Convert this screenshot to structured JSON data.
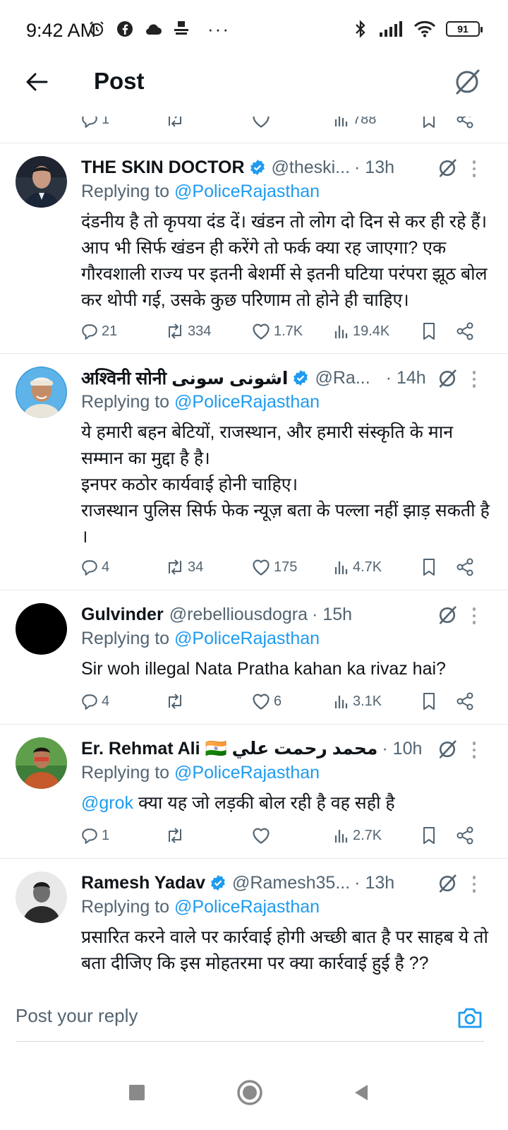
{
  "status_bar": {
    "time": "9:42 AM",
    "battery": "91",
    "icons": [
      "alarm-icon",
      "facebook-icon",
      "cloud-icon",
      "news-app-icon",
      "more-dots",
      "bluetooth-icon",
      "signal-icon",
      "wifi-icon",
      "battery-icon"
    ]
  },
  "header": {
    "title": "Post"
  },
  "partial_row": {
    "replies": "1",
    "views": "788"
  },
  "tweets": [
    {
      "name": "THE SKIN DOCTOR",
      "verified": true,
      "handle": "@theski...",
      "time": "· 13h",
      "replying_prefix": "Replying to",
      "replying_to": "@PoliceRajasthan",
      "body_lines": [
        "दंडनीय है तो कृपया दंड दें। खंडन तो लोग दो दिन से कर ही रहे हैं। आप भी सिर्फ खंडन ही करेंगे तो फर्क क्या रह जाएगा? एक गौरवशाली राज्य पर इतनी बेशर्मी से इतनी घटिया परंपरा झूठ बोल कर थोपी गई, उसके कुछ परिणाम तो होने ही चाहिए।"
      ],
      "replies": "21",
      "reposts": "334",
      "likes": "1.7K",
      "views": "19.4K"
    },
    {
      "name": "अश्विनी सोनी اشونی سونی",
      "verified": true,
      "handle": "@Ra...",
      "time": "· 14h",
      "replying_prefix": "Replying to",
      "replying_to": "@PoliceRajasthan",
      "body_lines": [
        "ये हमारी बहन बेटियों, राजस्थान, और हमारी संस्कृति के मान सम्मान का मुद्दा है है।",
        "इनपर कठोर कार्यवाई होनी चाहिए।",
        "राजस्थान पुलिस सिर्फ फेक न्यूज़ बता के पल्ला नहीं झाड़ सकती है ।"
      ],
      "replies": "4",
      "reposts": "34",
      "likes": "175",
      "views": "4.7K"
    },
    {
      "name": "Gulvinder",
      "verified": false,
      "handle": "@rebelliousdogra",
      "time": "· 15h",
      "replying_prefix": "Replying to",
      "replying_to": "@PoliceRajasthan",
      "body_lines": [
        "Sir woh illegal Nata Pratha kahan ka rivaz hai?"
      ],
      "replies": "4",
      "reposts": "",
      "likes": "6",
      "views": "3.1K"
    },
    {
      "name": "Er. Rehmat Ali 🇮🇳 محمد رحمت علي",
      "verified": false,
      "handle": "",
      "time": "· 10h",
      "replying_prefix": "Replying to",
      "replying_to": "@PoliceRajasthan",
      "body_mention": "@grok",
      "body_lines": [
        "क्या यह जो लड़की बोल रही है वह सही है"
      ],
      "replies": "1",
      "reposts": "",
      "likes": "",
      "views": "2.7K"
    },
    {
      "name": "Ramesh Yadav",
      "verified": true,
      "handle": "@Ramesh35...",
      "time": "· 13h",
      "replying_prefix": "Replying to",
      "replying_to": "@PoliceRajasthan",
      "body_lines": [
        "प्रसारित करने वाले पर कार्रवाई होगी अच्छी बात है पर साहब ये तो बता दीजिए कि इस मोहतरमा पर क्या कार्रवाई हुई है ??"
      ]
    }
  ],
  "reply_bar": {
    "placeholder": "Post your reply"
  },
  "colors": {
    "accent": "#1d9bf0",
    "text": "#0f1419",
    "muted": "#536471"
  }
}
